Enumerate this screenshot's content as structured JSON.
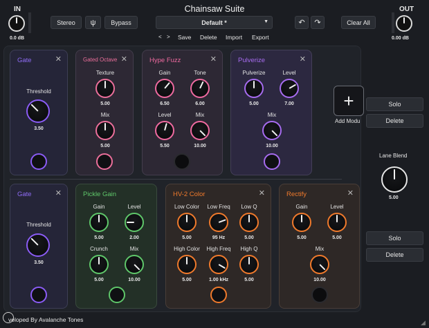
{
  "header": {
    "title": "Chainsaw Suite",
    "in_label": "IN",
    "in_value": "0.0 dB",
    "out_label": "OUT",
    "out_value": "0.00 dB",
    "stereo_label": "Stereo",
    "bypass_label": "Bypass",
    "preset_name": "Default *",
    "prev_label": "<",
    "next_label": ">",
    "save_label": "Save",
    "delete_label": "Delete",
    "import_label": "Import",
    "export_label": "Export",
    "clear_all_label": "Clear All"
  },
  "lane1": {
    "gate": {
      "title": "Gate",
      "threshold_label": "Threshold",
      "threshold_value": "3.50"
    },
    "gated_octave": {
      "title": "Gated Octave",
      "texture_label": "Texture",
      "texture_value": "5.00",
      "mix_label": "Mix",
      "mix_value": "5.00"
    },
    "hype_fuzz": {
      "title": "Hype Fuzz",
      "gain_label": "Gain",
      "gain_value": "6.50",
      "tone_label": "Tone",
      "tone_value": "6.00",
      "level_label": "Level",
      "level_value": "5.50",
      "mix_label": "Mix",
      "mix_value": "10.00"
    },
    "pulverize": {
      "title": "Pulverize",
      "pulverize_label": "Pulverize",
      "pulverize_value": "5.00",
      "level_label": "Level",
      "level_value": "7.00",
      "mix_label": "Mix",
      "mix_value": "10.00"
    },
    "add_module_label": "Add Modu"
  },
  "lane2": {
    "gate": {
      "title": "Gate",
      "threshold_label": "Threshold",
      "threshold_value": "3.50"
    },
    "pickle_gain": {
      "title": "Pickle Gain",
      "gain_label": "Gain",
      "gain_value": "5.00",
      "level_label": "Level",
      "level_value": "2.00",
      "crunch_label": "Crunch",
      "crunch_value": "5.00",
      "mix_label": "Mix",
      "mix_value": "10.00"
    },
    "hv2": {
      "title": "HV-2 Color",
      "low_color_label": "Low Color",
      "low_color_value": "5.00",
      "low_freq_label": "Low Freq",
      "low_freq_value": "95 Hz",
      "low_q_label": "Low Q",
      "low_q_value": "5.00",
      "high_color_label": "High Color",
      "high_color_value": "5.00",
      "high_freq_label": "High Freq",
      "high_freq_value": "1.00 kHz",
      "high_q_label": "High Q",
      "high_q_value": "5.00"
    },
    "rectify": {
      "title": "Rectify",
      "gain_label": "Gain",
      "gain_value": "5.00",
      "level_label": "Level",
      "level_value": "5.00",
      "mix_label": "Mix",
      "mix_value": "10.00"
    }
  },
  "side": {
    "solo1_label": "Solo",
    "delete1_label": "Delete",
    "lane_blend_label": "Lane Blend",
    "lane_blend_value": "5.00",
    "solo2_label": "Solo",
    "delete2_label": "Delete"
  },
  "footer": {
    "credit": "veloped By Avalanche Tones"
  },
  "colors": {
    "gate": "#8b5cf6",
    "gated_octave": "#ec6f9b",
    "hype_fuzz": "#ef6aa0",
    "pulverize": "#a76cf0",
    "pickle_gain": "#5fc76a",
    "hv2": "#f07a2c",
    "rectify": "#f07a2c"
  }
}
